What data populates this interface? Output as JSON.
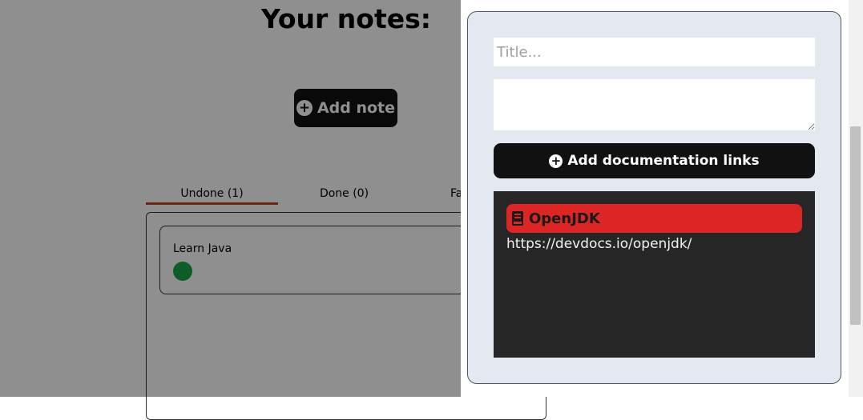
{
  "page": {
    "title": "Your notes:",
    "add_note_label": "Add note"
  },
  "tabs": [
    {
      "label": "Undone (1)",
      "active": true
    },
    {
      "label": "Done (0)",
      "active": false
    },
    {
      "label": "Fa",
      "active": false
    }
  ],
  "notes": [
    {
      "title": "Learn Java",
      "status_color": "#1aa64a"
    }
  ],
  "drawer": {
    "title_placeholder": "Title...",
    "description_value": "",
    "add_links_label": "Add documentation links",
    "links": [
      {
        "name": "OpenJDK",
        "url": "https://devdocs.io/openjdk/",
        "icon": "book-icon",
        "color": "#dc2626"
      }
    ]
  },
  "colors": {
    "accent_tab": "#c0441c",
    "drawer_bg": "#e4e9f1",
    "links_bg": "#262626"
  }
}
